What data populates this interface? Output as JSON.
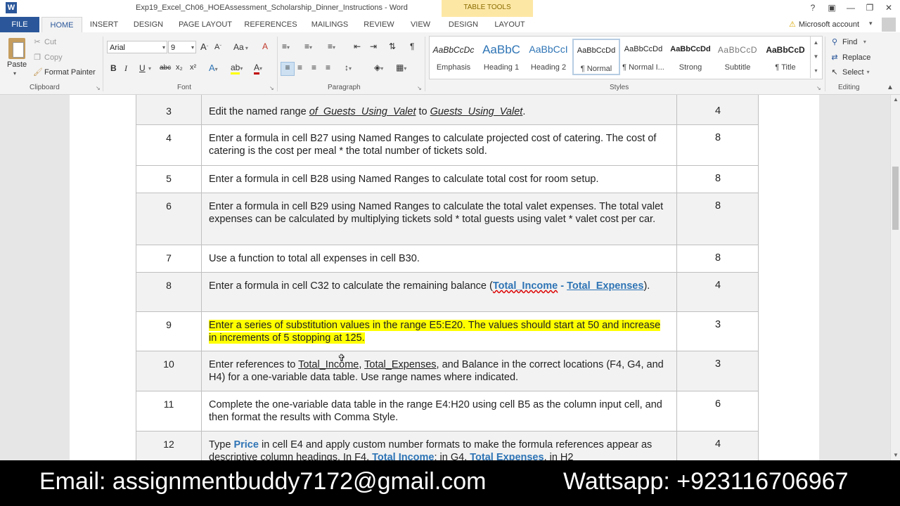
{
  "app": {
    "title": "Exp19_Excel_Ch06_HOEAssessment_Scholarship_Dinner_Instructions - Word",
    "logo": "W",
    "contextual_group": "TABLE TOOLS",
    "window_controls": [
      "?",
      "▣",
      "—",
      "❐",
      "✕"
    ]
  },
  "tabs": [
    {
      "label": "FILE"
    },
    {
      "label": "HOME"
    },
    {
      "label": "INSERT"
    },
    {
      "label": "DESIGN"
    },
    {
      "label": "PAGE LAYOUT"
    },
    {
      "label": "REFERENCES"
    },
    {
      "label": "MAILINGS"
    },
    {
      "label": "REVIEW"
    },
    {
      "label": "VIEW"
    },
    {
      "label": "DESIGN"
    },
    {
      "label": "LAYOUT"
    }
  ],
  "account": {
    "label": "Microsoft account"
  },
  "ribbon": {
    "clipboard": {
      "group_label": "Clipboard",
      "paste": "Paste",
      "cut": "Cut",
      "copy": "Copy",
      "format_painter": "Format Painter"
    },
    "font": {
      "group_label": "Font",
      "font_name": "Arial",
      "font_size": "9",
      "bold": "B",
      "italic": "I",
      "underline": "U",
      "strikethrough": "abc",
      "subscript": "x₂",
      "superscript": "x²",
      "grow": "A",
      "shrink": "A",
      "case": "Aa",
      "clear": "A",
      "effects": "A",
      "highlight": "ab",
      "color": "A"
    },
    "paragraph": {
      "group_label": "Paragraph"
    },
    "styles": {
      "group_label": "Styles",
      "items": [
        {
          "preview": "AaBbCcDc",
          "name": "Emphasis"
        },
        {
          "preview": "AaBbC",
          "name": "Heading 1"
        },
        {
          "preview": "AaBbCcI",
          "name": "Heading 2"
        },
        {
          "preview": "AaBbCcDd",
          "name": "¶ Normal"
        },
        {
          "preview": "AaBbCcDd",
          "name": "¶ Normal I..."
        },
        {
          "preview": "AaBbCcDd",
          "name": "Strong"
        },
        {
          "preview": "AaBbCcD",
          "name": "Subtitle"
        },
        {
          "preview": "AaBbCcD",
          "name": "¶ Title"
        }
      ]
    },
    "editing": {
      "group_label": "Editing",
      "find": "Find",
      "replace": "Replace",
      "select": "Select"
    }
  },
  "table": {
    "rows": [
      {
        "num": "3",
        "points": "4",
        "parts": [
          "Edit the named range ",
          "of_Guests_Using_Valet",
          " to ",
          "Guests_Using_Valet",
          "."
        ]
      },
      {
        "num": "4",
        "points": "8",
        "text": "Enter a formula in cell B27 using Named Ranges to calculate projected cost of catering. The cost of catering is the cost per meal * the total number of tickets sold."
      },
      {
        "num": "5",
        "points": "8",
        "text": "Enter a formula in cell B28 using Named Ranges to calculate total cost for room setup."
      },
      {
        "num": "6",
        "points": "8",
        "text": "Enter a formula in cell B29 using Named Ranges to calculate the total valet expenses. The total valet expenses can be calculated by multiplying tickets sold * total guests using valet * valet cost per car."
      },
      {
        "num": "7",
        "points": "8",
        "text": "Use a function to total all expenses in cell B30."
      },
      {
        "num": "8",
        "points": "4",
        "parts": [
          "Enter a formula in cell C32 to calculate the remaining balance (",
          "Total_Income",
          " - ",
          "Total_Expenses",
          ")."
        ]
      },
      {
        "num": "9",
        "points": "3",
        "text": "Enter a series of substitution values in the range E5:E20. The values should start at 50 and increase in increments of 5 stopping at 125."
      },
      {
        "num": "10",
        "points": "3",
        "parts": [
          "Enter references to ",
          "Total_Income",
          ", ",
          "Total_Expenses",
          ", and Balance in the correct locations (F4, G4, and H4) for a one-variable data table. Use range names where indicated."
        ]
      },
      {
        "num": "11",
        "points": "6",
        "text": "Complete the one-variable data table in the range E4:H20 using cell B5 as the column input cell, and then format the results with Comma Style."
      },
      {
        "num": "12",
        "points": "4",
        "parts": [
          "Type ",
          "Price",
          " in cell E4 and apply custom number formats to make the formula references appear as descriptive column headings. In F4, ",
          "Total Income",
          "; in G4, ",
          "Total Expenses",
          ", in H2"
        ]
      }
    ]
  },
  "footer": {
    "email": "Email:  assignmentbuddy7172@gmail.com",
    "whatsapp": "Wattsapp: +923116706967"
  }
}
